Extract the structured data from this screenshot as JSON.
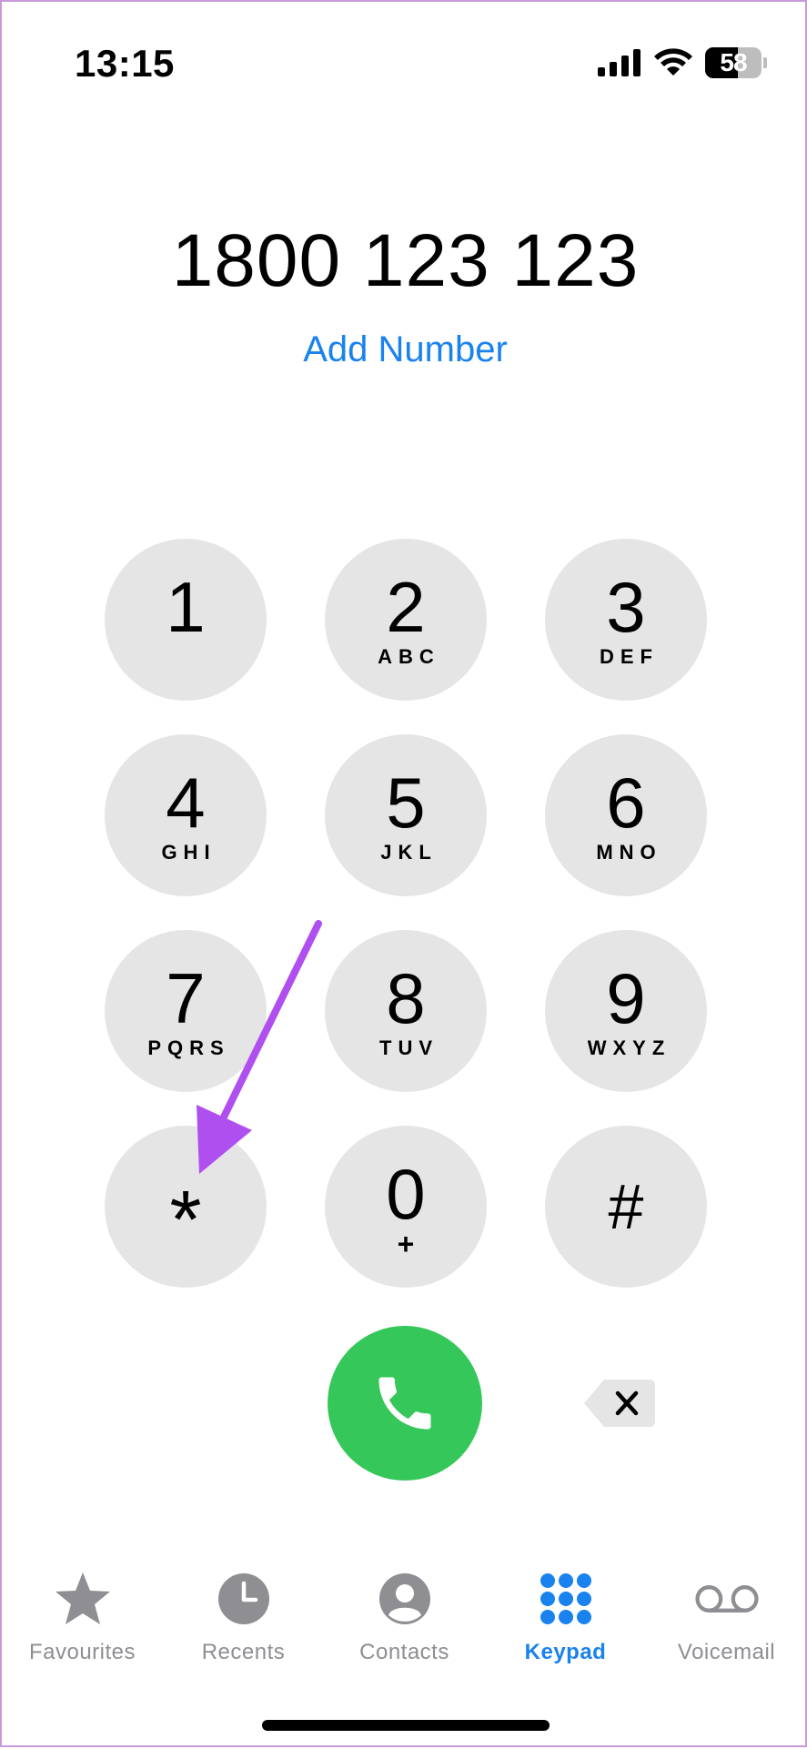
{
  "status_bar": {
    "time": "13:15",
    "battery_level": "58",
    "battery_fraction": 0.58
  },
  "dialer": {
    "number": "1800 123 123",
    "add_number_label": "Add Number"
  },
  "keypad": {
    "keys": [
      {
        "digit": "1",
        "letters": ""
      },
      {
        "digit": "2",
        "letters": "ABC"
      },
      {
        "digit": "3",
        "letters": "DEF"
      },
      {
        "digit": "4",
        "letters": "GHI"
      },
      {
        "digit": "5",
        "letters": "JKL"
      },
      {
        "digit": "6",
        "letters": "MNO"
      },
      {
        "digit": "7",
        "letters": "PQRS"
      },
      {
        "digit": "8",
        "letters": "TUV"
      },
      {
        "digit": "9",
        "letters": "WXYZ"
      },
      {
        "digit": "*",
        "letters": ""
      },
      {
        "digit": "0",
        "letters": "+"
      },
      {
        "digit": "#",
        "letters": ""
      }
    ],
    "call_icon": "phone-icon",
    "delete_icon": "backspace-icon"
  },
  "tabs": [
    {
      "label": "Favourites",
      "icon": "star-icon",
      "active": false
    },
    {
      "label": "Recents",
      "icon": "clock-icon",
      "active": false
    },
    {
      "label": "Contacts",
      "icon": "person-icon",
      "active": false
    },
    {
      "label": "Keypad",
      "icon": "keypad-icon",
      "active": true
    },
    {
      "label": "Voicemail",
      "icon": "voicemail-icon",
      "active": false
    }
  ],
  "colors": {
    "accent": "#1a82ee",
    "call_green": "#35c759",
    "key_background": "#e5e5e5",
    "inactive_tab": "#8e8e93",
    "annotation_arrow": "#b04fef"
  }
}
